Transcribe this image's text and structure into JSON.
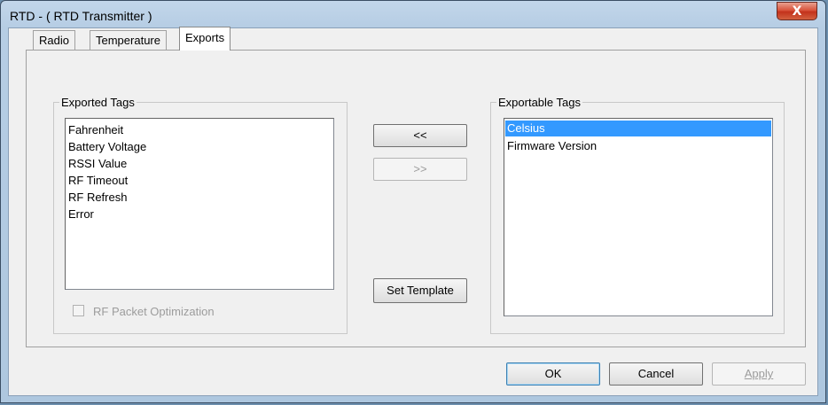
{
  "window": {
    "title": "RTD - ( RTD Transmitter )",
    "close_glyph": "X"
  },
  "tabs": [
    {
      "label": "Radio",
      "active": false
    },
    {
      "label": "Temperature",
      "active": false
    },
    {
      "label": "Exports",
      "active": true
    }
  ],
  "exported": {
    "legend": "Exported Tags",
    "items": [
      "Fahrenheit",
      "Battery Voltage",
      "RSSI Value",
      "RF Timeout",
      "RF Refresh",
      "Error"
    ],
    "checkbox_label": "RF Packet Optimization",
    "checkbox_checked": false,
    "checkbox_enabled": false
  },
  "exportable": {
    "legend": "Exportable Tags",
    "items": [
      "Celsius",
      "Firmware Version"
    ],
    "selected": "Celsius"
  },
  "buttons": {
    "add": "<<",
    "remove": ">>",
    "set_template": "Set Template",
    "ok": "OK",
    "cancel": "Cancel",
    "apply": "Apply"
  },
  "colors": {
    "selection": "#3399ff",
    "close_button": "#c3321c",
    "title_bar": "#b6cde4"
  }
}
